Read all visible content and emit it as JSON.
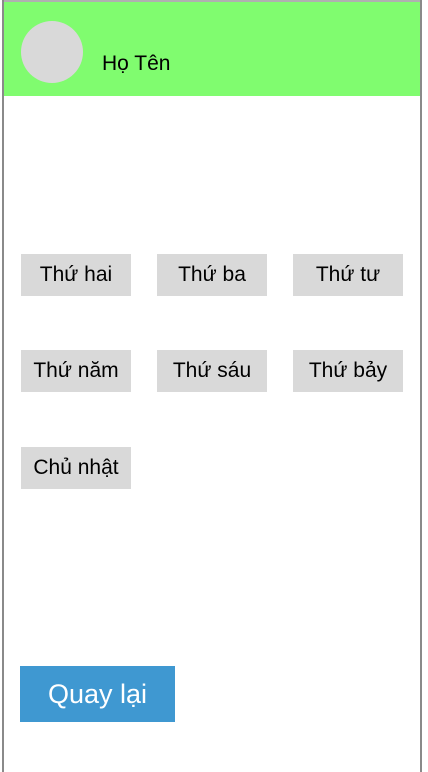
{
  "colors": {
    "header_bg": "#80fc6f",
    "avatar_bg": "#d9d9d9",
    "day_button_bg": "#d9d9d9",
    "back_button_bg": "#3f98d1",
    "back_button_text": "#ffffff"
  },
  "header": {
    "avatar_icon": "avatar-placeholder",
    "user_name": "Họ Tên"
  },
  "days": [
    {
      "label": "Thứ hai"
    },
    {
      "label": "Thứ ba"
    },
    {
      "label": "Thứ tư"
    },
    {
      "label": "Thứ năm"
    },
    {
      "label": "Thứ sáu"
    },
    {
      "label": "Thứ bảy"
    },
    {
      "label": "Chủ nhật"
    }
  ],
  "footer": {
    "back_label": "Quay lại"
  }
}
